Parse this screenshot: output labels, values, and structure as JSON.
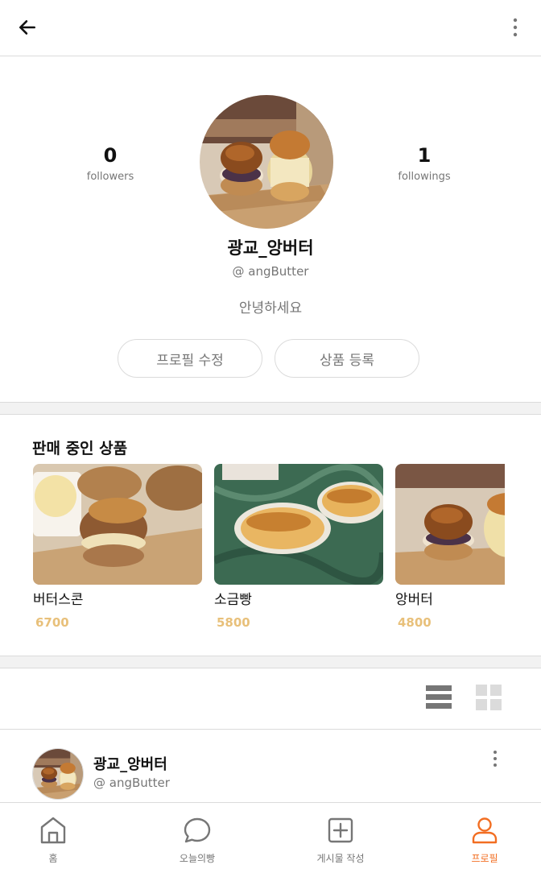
{
  "colors": {
    "accent": "#f26e22",
    "price": "#e8c07a",
    "muted": "#767676",
    "border": "#dbdbdb"
  },
  "header": {
    "back_icon": "arrow-left-icon",
    "more_icon": "vertical-dots-icon"
  },
  "profile": {
    "followers_count": "0",
    "followers_label": "followers",
    "followings_count": "1",
    "followings_label": "followings",
    "name": "광교_앙버터",
    "account_id": "@ angButter",
    "intro": "안녕하세요",
    "edit_button": "프로필 수정",
    "add_product_button": "상품 등록"
  },
  "products": {
    "title": "판매 중인 상품",
    "items": [
      {
        "name": "버터스콘",
        "price": "6700"
      },
      {
        "name": "소금빵",
        "price": "5800"
      },
      {
        "name": "앙버터",
        "price": "4800"
      }
    ]
  },
  "post": {
    "name": "광교_앙버터",
    "account_id": "@ angButter"
  },
  "tabbar": {
    "items": [
      {
        "label": "홈",
        "icon": "home-icon"
      },
      {
        "label": "오늘의빵",
        "icon": "chat-bubble-icon"
      },
      {
        "label": "게시물 작성",
        "icon": "add-post-icon"
      },
      {
        "label": "프로필",
        "icon": "user-icon"
      }
    ],
    "active": "프로필"
  }
}
